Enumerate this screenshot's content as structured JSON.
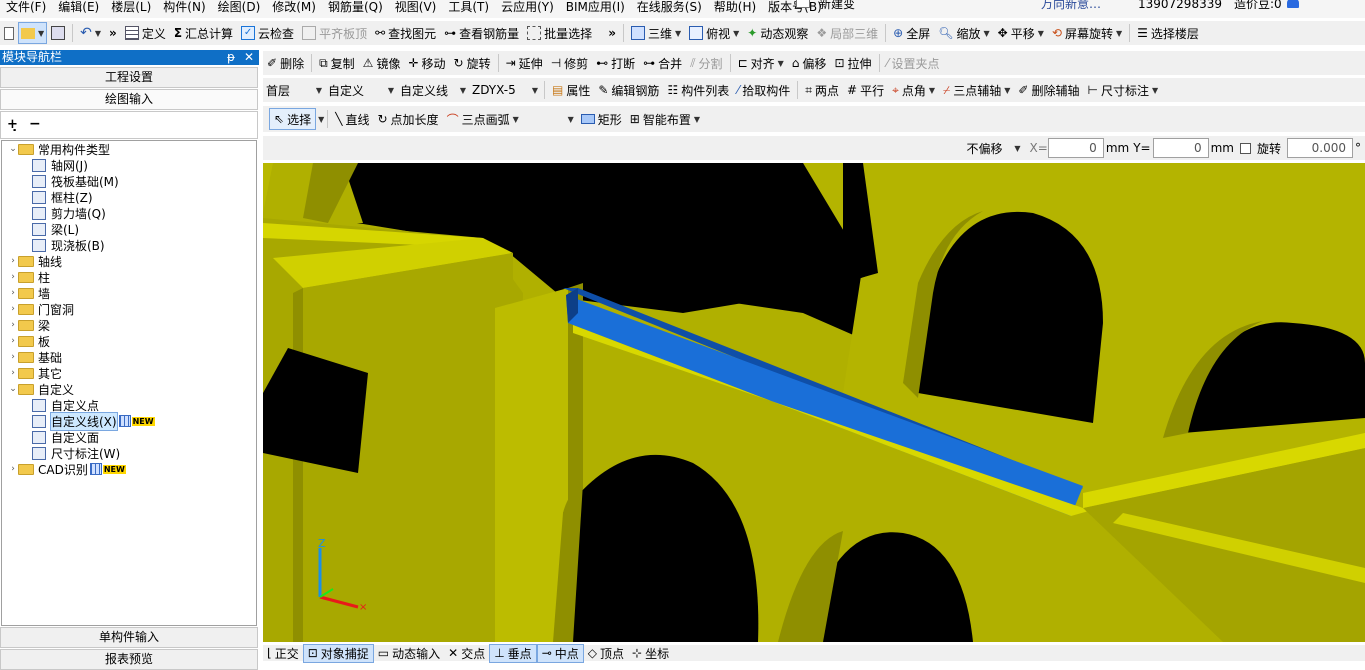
{
  "menu": [
    "文件(F)",
    "编辑(E)",
    "楼层(L)",
    "构件(N)",
    "绘图(D)",
    "修改(M)",
    "钢筋量(Q)",
    "视图(V)",
    "工具(T)",
    "云应用(Y)",
    "BIM应用(I)",
    "在线服务(S)",
    "帮助(H)",
    "版本号(B)"
  ],
  "menu_extra": {
    "new_label": "新建变",
    "slogan": "万向新意…",
    "phone": "13907298339",
    "price": "造价豆:0"
  },
  "toolbar1": {
    "define": "定义",
    "sum_calc": "汇总计算",
    "cloud_check": "云检查",
    "level_top": "平齐板顶",
    "find_element": "查找图元",
    "view_rebar": "查看钢筋量",
    "batch_select": "批量选择",
    "view3d": "三维",
    "top_view": "俯视",
    "dynamic_view": "动态观察",
    "local3d": "局部三维",
    "fullscreen": "全屏",
    "zoom": "缩放",
    "pan": "平移",
    "screen_rotate": "屏幕旋转",
    "select_floor": "选择楼层"
  },
  "toolbar2": {
    "delete": "删除",
    "copy": "复制",
    "mirror": "镜像",
    "move": "移动",
    "rotate": "旋转",
    "extend": "延伸",
    "trim": "修剪",
    "break": "打断",
    "merge": "合并",
    "split": "分割",
    "align": "对齐",
    "offset": "偏移",
    "stretch": "拉伸",
    "set_grip": "设置夹点"
  },
  "toolbar3": {
    "floor": "首层",
    "category": "自定义",
    "type": "自定义线",
    "name": "ZDYX-5",
    "property": "属性",
    "edit_rebar": "编辑钢筋",
    "element_list": "构件列表",
    "pick_element": "拾取构件",
    "two_points": "两点",
    "parallel": "平行",
    "point_angle": "点角",
    "three_point_aux": "三点辅轴",
    "delete_aux": "删除辅轴",
    "dim": "尺寸标注"
  },
  "toolbar4": {
    "select": "选择",
    "line": "直线",
    "point_length": "点加长度",
    "arc": "三点画弧",
    "rect": "矩形",
    "smart_layout": "智能布置"
  },
  "offset_bar": {
    "mode": "不偏移",
    "x_label": "X=",
    "x_value": "0",
    "y_label": "Y=",
    "y_value": "0",
    "unit": "mm",
    "rotate_label": "旋转",
    "rotate_value": "0.000",
    "degree": "°"
  },
  "nav": {
    "title": "模块导航栏",
    "project_settings": "工程设置",
    "drawing_input": "绘图输入",
    "single_input": "单构件输入",
    "report_preview": "报表预览",
    "tree": [
      {
        "label": "常用构件类型",
        "level": 0,
        "type": "folder",
        "open": true
      },
      {
        "label": "轴网(J)",
        "level": 1,
        "type": "leaf"
      },
      {
        "label": "筏板基础(M)",
        "level": 1,
        "type": "leaf"
      },
      {
        "label": "框柱(Z)",
        "level": 1,
        "type": "leaf"
      },
      {
        "label": "剪力墙(Q)",
        "level": 1,
        "type": "leaf"
      },
      {
        "label": "梁(L)",
        "level": 1,
        "type": "leaf"
      },
      {
        "label": "现浇板(B)",
        "level": 1,
        "type": "leaf"
      },
      {
        "label": "轴线",
        "level": 0,
        "type": "folder"
      },
      {
        "label": "柱",
        "level": 0,
        "type": "folder"
      },
      {
        "label": "墙",
        "level": 0,
        "type": "folder"
      },
      {
        "label": "门窗洞",
        "level": 0,
        "type": "folder"
      },
      {
        "label": "梁",
        "level": 0,
        "type": "folder"
      },
      {
        "label": "板",
        "level": 0,
        "type": "folder"
      },
      {
        "label": "基础",
        "level": 0,
        "type": "folder"
      },
      {
        "label": "其它",
        "level": 0,
        "type": "folder"
      },
      {
        "label": "自定义",
        "level": 0,
        "type": "folder",
        "open": true
      },
      {
        "label": "自定义点",
        "level": 1,
        "type": "leaf"
      },
      {
        "label": "自定义线(X)",
        "level": 1,
        "type": "leaf",
        "selected": true,
        "badge": "NEW"
      },
      {
        "label": "自定义面",
        "level": 1,
        "type": "leaf"
      },
      {
        "label": "尺寸标注(W)",
        "level": 1,
        "type": "leaf"
      },
      {
        "label": "CAD识别",
        "level": 0,
        "type": "folder",
        "badge": "NEW"
      }
    ]
  },
  "status": {
    "ortho": "正交",
    "snap": "对象捕捉",
    "dyn_input": "动态输入",
    "intersection": "交点",
    "perpendicular": "垂点",
    "midpoint": "中点",
    "vertex": "顶点",
    "coordinate": "坐标"
  },
  "axes": {
    "z": "Z"
  },
  "colors": {
    "wall": "#b8b800",
    "wall_dark": "#8f8f00",
    "wall_light": "#d8d800",
    "beam": "#1a6fd8",
    "nav_title": "#0f6fc6",
    "viewport_bg": "#000000"
  }
}
